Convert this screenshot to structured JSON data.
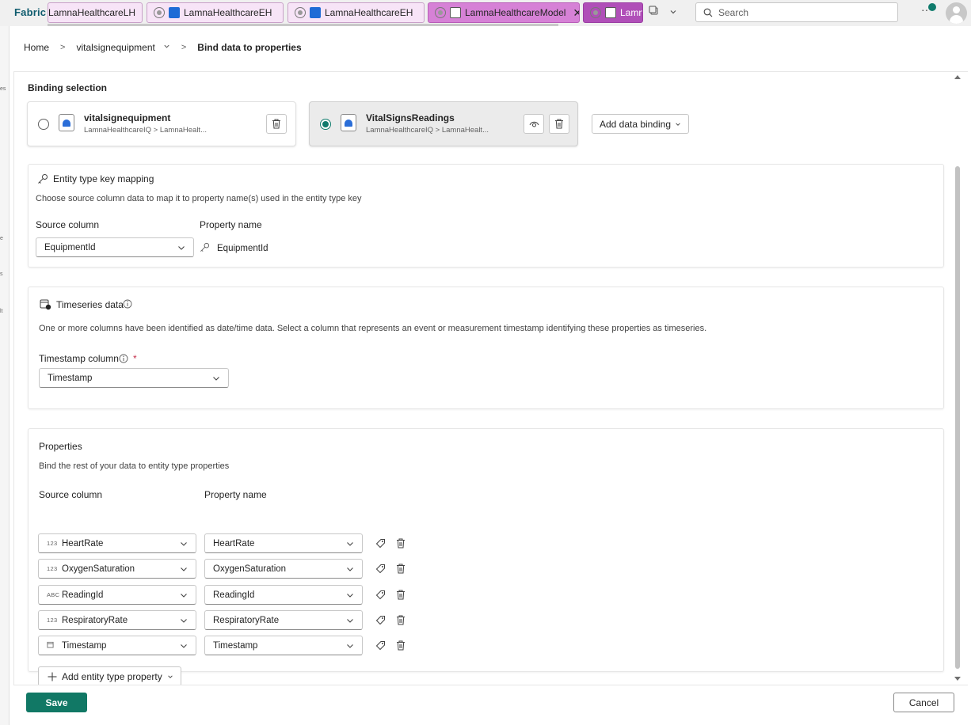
{
  "app": {
    "brand": "Fabric"
  },
  "tabs": [
    {
      "label": "LamnaHealthcareLH",
      "state": "normal"
    },
    {
      "label": "LamnaHealthcareEH",
      "state": "normal"
    },
    {
      "label": "LamnaHealthcareEH",
      "state": "normal"
    },
    {
      "label": "LamnaHealthcareModel",
      "state": "active"
    },
    {
      "label": "Lamn",
      "state": "purple"
    }
  ],
  "search": {
    "placeholder": "Search"
  },
  "rail_fragments": [
    "es",
    "e",
    "s",
    "lt"
  ],
  "breadcrumb": {
    "home": "Home",
    "entity": "vitalsignequipment",
    "current": "Bind data to properties"
  },
  "binding": {
    "title": "Binding selection",
    "cards": [
      {
        "name": "vitalsignequipment",
        "path": "LamnaHealthcareIQ > LamnaHealt...",
        "selected": false
      },
      {
        "name": "VitalSignsReadings",
        "path": "LamnaHealthcareIQ > LamnaHealt...",
        "selected": true
      }
    ],
    "add_label": "Add data binding"
  },
  "key_mapping": {
    "title": "Entity type key mapping",
    "description": "Choose source column data to map it to property name(s) used in the entity type key",
    "source_header": "Source column",
    "property_header": "Property name",
    "source_value": "EquipmentId",
    "property_value": "EquipmentId"
  },
  "timeseries": {
    "title": "Timeseries data",
    "description": "One or more columns have been identified as date/time data. Select a column that represents an event or measurement timestamp identifying these properties as timeseries.",
    "column_label": "Timestamp column",
    "required_mark": "*",
    "column_value": "Timestamp"
  },
  "properties": {
    "title": "Properties",
    "description": "Bind the rest of your data to entity type properties",
    "source_header": "Source column",
    "property_header": "Property name",
    "rows": [
      {
        "type": "123",
        "source": "HeartRate",
        "property": "HeartRate"
      },
      {
        "type": "123",
        "source": "OxygenSaturation",
        "property": "OxygenSaturation"
      },
      {
        "type": "ABC",
        "source": "ReadingId",
        "property": "ReadingId"
      },
      {
        "type": "123",
        "source": "RespiratoryRate",
        "property": "RespiratoryRate"
      },
      {
        "type": "calendar-icon",
        "source": "Timestamp",
        "property": "Timestamp"
      }
    ],
    "add_label": "Add entity type property"
  },
  "footer": {
    "save": "Save",
    "cancel": "Cancel"
  },
  "colors": {
    "accent": "#117865",
    "tab_active": "#d681d6",
    "tab_normal": "#f7e4f7"
  }
}
